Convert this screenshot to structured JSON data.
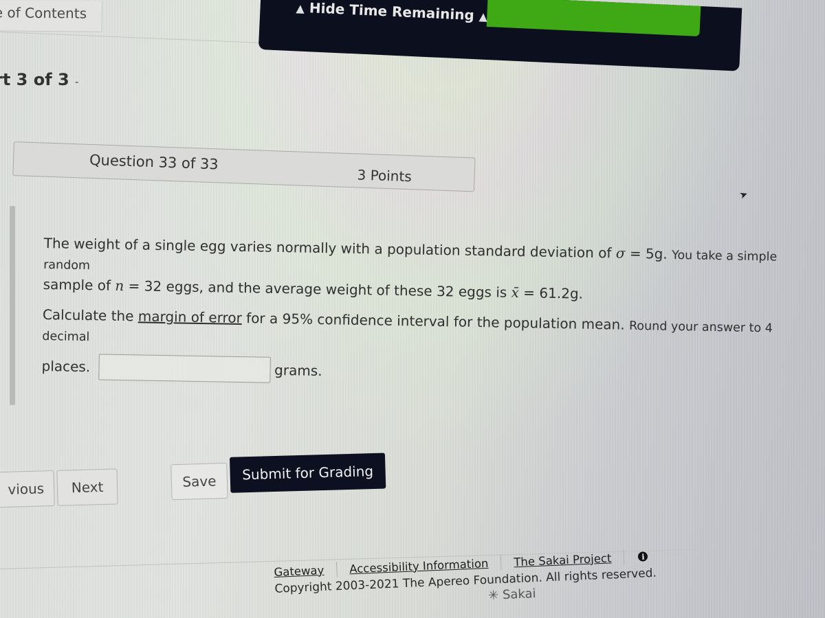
{
  "toc_tab": {
    "label": "e of Contents"
  },
  "timer": {
    "toggle_label": "Hide Time Remaining",
    "toggle_icon_left": "▲",
    "toggle_icon_right": "▲",
    "bar_color": "#3ea815",
    "panel_color": "#0c0f1e"
  },
  "part": {
    "label": "rt 3 of 3",
    "suffix": "-"
  },
  "question": {
    "number_label": "Question 33 of 33",
    "points_label": "3 Points",
    "text_line1_a": "The weight of a single egg varies normally with a population standard deviation of ",
    "sigma_symbol": "σ",
    "sigma_eq": " = 5g. ",
    "text_line1_b": "You take a simple random",
    "text_line2_a": "sample of ",
    "n_symbol": "n",
    "n_eq": " = 32 eggs, and the average weight of these 32 eggs is ",
    "xbar_symbol": "x̄",
    "xbar_eq": " = 61.2g.",
    "prompt_a": "Calculate the ",
    "prompt_link": "margin of error",
    "prompt_b": " for a 95% confidence interval for the population mean. ",
    "prompt_c": "Round your answer to 4 decimal",
    "prompt_d": "places.",
    "answer_value": "",
    "answer_placeholder": "",
    "unit": "grams."
  },
  "nav": {
    "previous_label": "vious",
    "next_label": "Next",
    "save_label": "Save",
    "submit_label": "Submit for Grading",
    "submit_color": "#0d1020"
  },
  "footer": {
    "links": [
      "Gateway",
      "Accessibility Information",
      "The Sakai Project"
    ],
    "info_icon": "i",
    "copyright": "Copyright 2003-2021 The Apereo Foundation. All rights reserved.",
    "logo_text": "✳ Sakai"
  }
}
